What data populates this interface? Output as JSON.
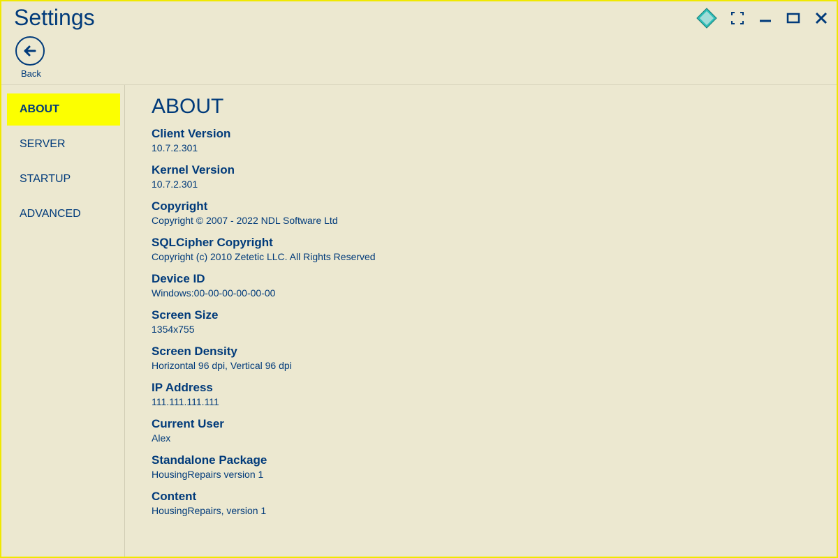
{
  "window": {
    "title": "Settings",
    "back_label": "Back"
  },
  "sidebar": {
    "items": [
      {
        "label": "ABOUT",
        "active": true
      },
      {
        "label": "SERVER",
        "active": false
      },
      {
        "label": "STARTUP",
        "active": false
      },
      {
        "label": "ADVANCED",
        "active": false
      }
    ]
  },
  "content": {
    "heading": "ABOUT",
    "items": [
      {
        "label": "Client Version",
        "value": "10.7.2.301"
      },
      {
        "label": "Kernel Version",
        "value": "10.7.2.301"
      },
      {
        "label": "Copyright",
        "value": "Copyright © 2007 - 2022 NDL Software Ltd"
      },
      {
        "label": "SQLCipher Copyright",
        "value": "Copyright (c) 2010 Zetetic LLC. All Rights Reserved"
      },
      {
        "label": "Device ID",
        "value": "Windows:00-00-00-00-00-00"
      },
      {
        "label": "Screen Size",
        "value": "1354x755"
      },
      {
        "label": "Screen Density",
        "value": "Horizontal 96 dpi, Vertical 96 dpi"
      },
      {
        "label": "IP Address",
        "value": "111.111.111.111"
      },
      {
        "label": "Current User",
        "value": "Alex"
      },
      {
        "label": "Standalone Package",
        "value": "HousingRepairs version 1"
      },
      {
        "label": "Content",
        "value": "HousingRepairs, version 1"
      }
    ]
  }
}
